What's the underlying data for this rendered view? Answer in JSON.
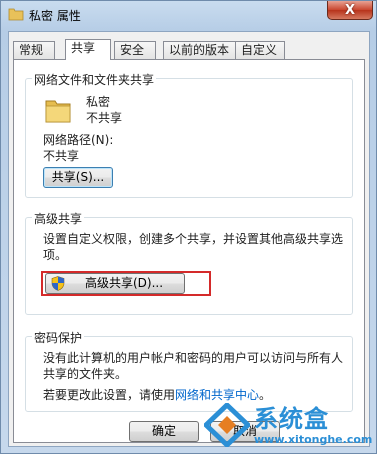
{
  "window": {
    "title": "私密 属性",
    "close_label": "X"
  },
  "tabs": [
    "常规",
    "共享",
    "安全",
    "以前的版本",
    "自定义"
  ],
  "network_share": {
    "group_title": "网络文件和文件夹共享",
    "folder_name": "私密",
    "folder_status": "不共享",
    "path_label": "网络路径(N):",
    "path_value": "不共享",
    "share_button": "共享(S)..."
  },
  "advanced_share": {
    "group_title": "高级共享",
    "description_line1": "设置自定义权限，创建多个共享，并设置其他高级共享选",
    "description_line2": "项。",
    "button": "高级共享(D)..."
  },
  "password": {
    "group_title": "密码保护",
    "line1": "没有此计算机的用户帐户和密码的用户可以访问与所有人",
    "line2": "共享的文件夹。",
    "line3_prefix": "若要更改此设置，请使用",
    "line3_link": "网络和共享中心",
    "line3_suffix": "。"
  },
  "footer": {
    "ok": "确定",
    "cancel": "取消"
  },
  "watermark": {
    "brand": "系统盒",
    "url": "www.xitonghe.com"
  },
  "colors": {
    "highlight_box": "#d42a2a",
    "link": "#0066cc"
  }
}
